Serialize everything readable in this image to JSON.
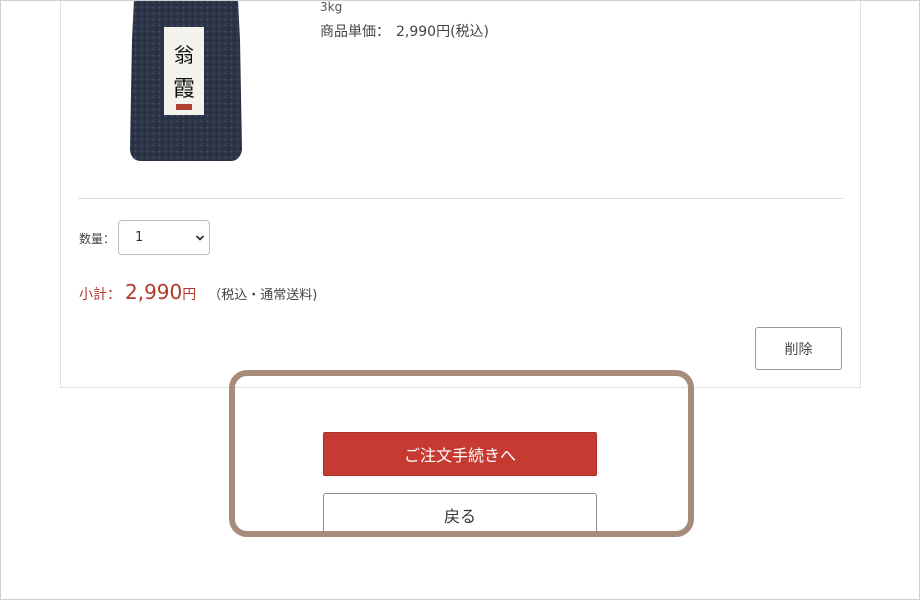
{
  "product": {
    "image_icon": "rice-bag-image",
    "weight": "3kg",
    "unit_price_label": "商品単価：",
    "unit_price_value": "2,990円(税込)"
  },
  "quantity": {
    "label": "数量：",
    "selected": "1",
    "icon": "chevron-down-icon"
  },
  "subtotal": {
    "label": "小計：",
    "amount": "2,990",
    "currency": "円",
    "note": "（税込・通常送料)"
  },
  "actions": {
    "delete_label": "削除",
    "order_label": "ご注文手続きへ",
    "back_label": "戻る"
  },
  "colors": {
    "accent_red": "#c53b31",
    "price_red": "#b23a2c",
    "highlight_border": "#a88c7b"
  }
}
